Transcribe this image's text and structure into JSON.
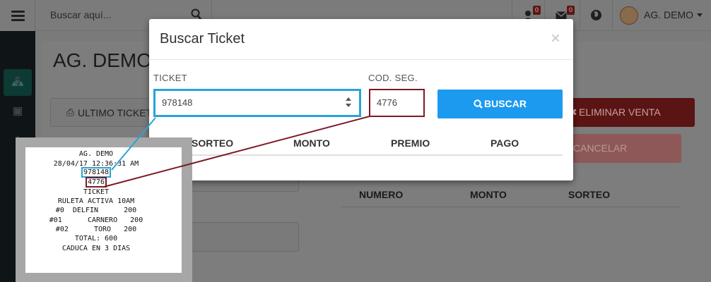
{
  "topbar": {
    "search_placeholder": "Buscar aquí...",
    "user_badge": "0",
    "mail_badge": "0",
    "user_name": "AG. DEMO"
  },
  "sidebar": {
    "icons": [
      "dashboard-icon",
      "dollar-icon",
      "money-icon",
      "list-icon",
      "list-icon"
    ]
  },
  "background": {
    "page_title": "AG. DEMO",
    "ultimo_ticket_label": "ULTIMO TICKET",
    "eliminar_venta_label": "ELIMINAR VENTA",
    "cancelar_label": "CANCELAR",
    "table_headers": [
      "NUMERO",
      "MONTO",
      "SORTEO"
    ],
    "colors": {
      "danger": "#8b1a1a"
    }
  },
  "modal": {
    "title": "Buscar Ticket",
    "close_label": "×",
    "ticket_label": "TICKET",
    "ticket_value": "978148",
    "cod_label": "COD. SEG.",
    "cod_value": "4776",
    "buscar_label": "BUSCAR",
    "table_headers": [
      "SORTEO",
      "MONTO",
      "PREMIO",
      "PAGO"
    ],
    "colors": {
      "primary": "#1c9af0",
      "ticket_highlight": "#2aa3d6",
      "cod_highlight": "#7b1a24"
    }
  },
  "receipt": {
    "lines": [
      "AG. DEMO",
      "28/04/17 12:36:31 AM",
      "978148",
      "4776",
      "TICKET",
      "RULETA ACTIVA 10AM",
      "#0  DELFIN      200",
      "#01      CARNERO   200",
      "#02      TORO   200",
      "TOTAL: 600",
      "CADUCA EN 3 DIAS"
    ]
  }
}
